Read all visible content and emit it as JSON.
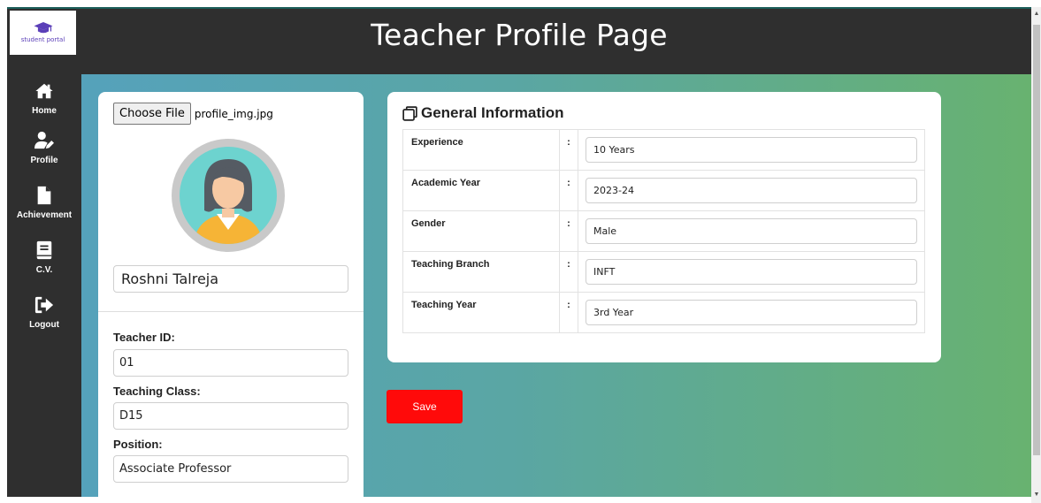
{
  "brand": {
    "logo_text": "student portal",
    "accent": "#5b3fb8"
  },
  "header": {
    "title": "Teacher Profile Page"
  },
  "sidebar": {
    "items": [
      {
        "label": "Home",
        "icon": "home-icon"
      },
      {
        "label": "Profile",
        "icon": "user-edit-icon"
      },
      {
        "label": "Achievement",
        "icon": "file-icon"
      },
      {
        "label": "C.V.",
        "icon": "book-icon"
      },
      {
        "label": "Logout",
        "icon": "sign-out-icon"
      }
    ]
  },
  "profile": {
    "file_button": "Choose File",
    "file_name": "profile_img.jpg",
    "name": "Roshni Talreja",
    "fields": [
      {
        "label": "Teacher ID:",
        "value": "01"
      },
      {
        "label": "Teaching Class:",
        "value": "D15"
      },
      {
        "label": "Position:",
        "value": "Associate Professor"
      }
    ]
  },
  "general_info": {
    "title": "General Information",
    "separator": ":",
    "rows": [
      {
        "label": "Experience",
        "value": "10 Years"
      },
      {
        "label": "Academic Year",
        "value": "2023-24"
      },
      {
        "label": "Gender",
        "value": "Male"
      },
      {
        "label": "Teaching Branch",
        "value": "INFT"
      },
      {
        "label": "Teaching Year",
        "value": "3rd Year"
      }
    ]
  },
  "actions": {
    "save_label": "Save",
    "save_color": "#ff0a0a"
  },
  "colors": {
    "header_bg": "#2f2f2f",
    "gradient_start": "#55a2bb",
    "gradient_end": "#68b270"
  }
}
